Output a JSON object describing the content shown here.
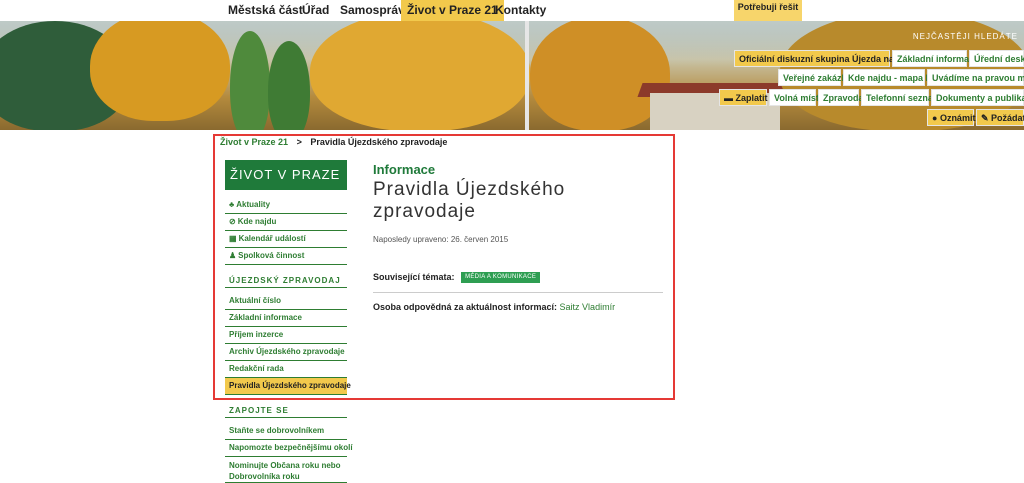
{
  "topnav": {
    "items": [
      "Městská část",
      "Úřad",
      "Samospráva",
      "Život v Praze 21",
      "Kontakty"
    ],
    "need_label": "Potřebuji řešit"
  },
  "banner": {
    "quick_label": "NEJČASTĚJI HLEDÁTE",
    "row1": [
      "Oficiální diskuzní skupina Újezda nad Lesy",
      "Základní informace",
      "Úřední deska"
    ],
    "row2": [
      "Veřejné zakázky",
      "Kde najdu - mapa MČ",
      "Uvádíme na pravou míru"
    ],
    "row3": [
      "Zaplatit",
      "Volná místa",
      "Zpravodaj",
      "Telefonní seznam",
      "Dokumenty a publikace"
    ],
    "row4": [
      "Oznámit",
      "Požádat"
    ]
  },
  "breadcrumb": {
    "link": "Život v Praze 21",
    "sep": ">",
    "current": "Pravidla Újezdského zpravodaje"
  },
  "sidebar": {
    "heading": "ŽIVOT V PRAZE 21",
    "items": [
      {
        "icon": "♣",
        "label": "Aktuality"
      },
      {
        "icon": "⊘",
        "label": "Kde najdu"
      },
      {
        "icon": "▦",
        "label": "Kalendář událostí"
      },
      {
        "icon": "♟",
        "label": "Spolková činnost"
      }
    ],
    "section1": "ÚJEZDSKÝ ZPRAVODAJ",
    "section1_items": [
      "Aktuální číslo",
      "Základní informace",
      "Příjem inzerce",
      "Archiv Újezdského zpravodaje",
      "Redakční rada",
      "Pravidla Újezdského zpravodaje"
    ],
    "section2": "ZAPOJTE SE",
    "section2_items": [
      "Staňte se dobrovolníkem",
      "Napomozte bezpečnějšímu okolí",
      "Nominujte Občana roku nebo Dobrovolníka roku"
    ]
  },
  "main": {
    "category": "Informace",
    "title": "Pravidla Újezdského zpravodaje",
    "updated": "Naposledy upraveno: 26. červen 2015",
    "topics_label": "Související témata:",
    "topic_tag": "MÉDIA A KOMUNIKACE",
    "responsible_label": "Osoba odpovědná za aktuálnost informací:",
    "responsible_person": "Saitz Vladimír"
  },
  "colors": {
    "accent_green": "#1f7a3a",
    "accent_yellow": "#f2c94c",
    "highlight_red": "#e53935"
  }
}
